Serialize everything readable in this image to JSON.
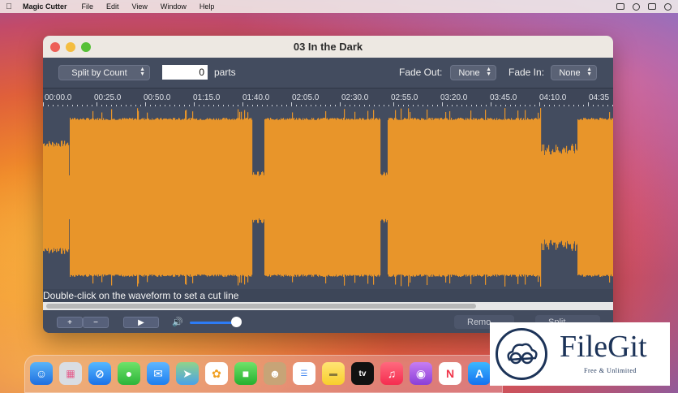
{
  "menubar": {
    "apple": "",
    "app_name": "Magic Cutter",
    "menus": [
      "File",
      "Edit",
      "View",
      "Window",
      "Help"
    ],
    "status_icons": [
      "keyboard-icon",
      "search-icon",
      "control-center-icon",
      "siri-icon"
    ]
  },
  "window": {
    "title": "03 In the Dark",
    "toolbar": {
      "split_mode": "Split by Count",
      "parts_value": "0",
      "parts_label": "parts",
      "fade_out_label": "Fade Out:",
      "fade_out_value": "None",
      "fade_in_label": "Fade In:",
      "fade_in_value": "None"
    },
    "ruler_ticks": [
      "00:00.0",
      "00:25.0",
      "00:50.0",
      "01:15.0",
      "01:40.0",
      "02:05.0",
      "02:30.0",
      "02:55.0",
      "03:20.0",
      "03:45.0",
      "04:10.0",
      "04:35"
    ],
    "hint": "Double-click on the waveform to set a cut line",
    "bottom": {
      "add": "+",
      "remove": "−",
      "play": "▶",
      "volume_icon": "🔊",
      "volume_level": 0.95,
      "remove_button": "Remo",
      "split_button": "Split"
    }
  },
  "colors": {
    "waveform": "#e8952a",
    "window_bg": "#434c5f",
    "accent": "#2d7cf6"
  },
  "dock": {
    "apps": [
      "Finder",
      "Launchpad",
      "Safari",
      "Messages",
      "Mail",
      "Maps",
      "Photos",
      "FaceTime",
      "Contacts",
      "Reminders",
      "Notes",
      "TV",
      "Music",
      "Podcasts",
      "News",
      "App Store"
    ]
  },
  "watermark": {
    "name": "FileGit",
    "tagline": "Free & Unlimited"
  }
}
